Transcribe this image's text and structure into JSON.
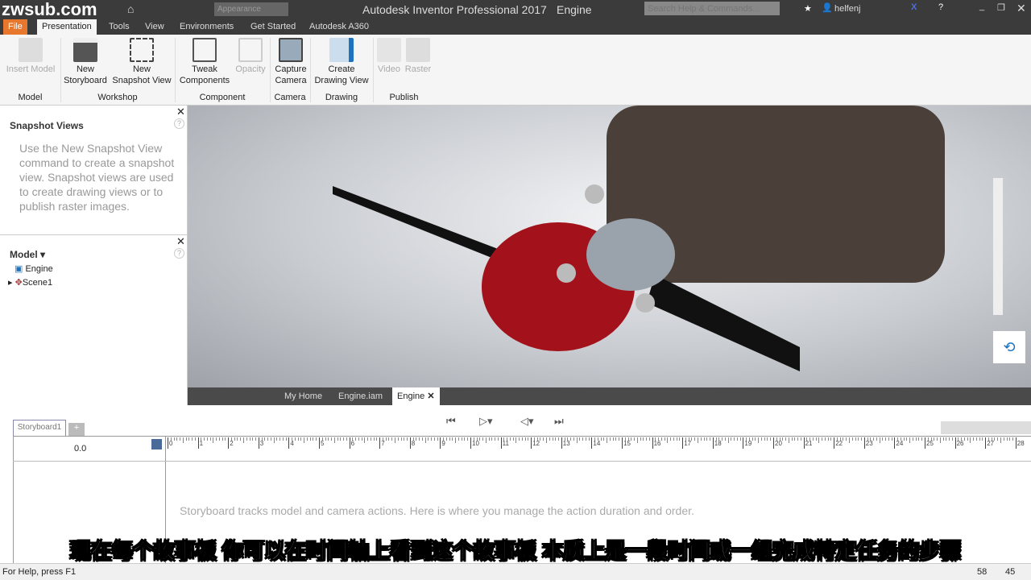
{
  "watermark": "zwsub.com",
  "title": {
    "app": "Autodesk Inventor Professional 2017",
    "doc": "Engine",
    "appearance": "Appearance",
    "search_placeholder": "Search Help & Commands...",
    "user": "helfenj"
  },
  "ribbon_tabs": [
    "File",
    "Presentation",
    "Tools",
    "View",
    "Environments",
    "Get Started",
    "Autodesk A360"
  ],
  "ribbon": {
    "buttons": [
      {
        "l1": "Insert Model",
        "l2": "",
        "disabled": true
      },
      {
        "l1": "New",
        "l2": "Storyboard",
        "disabled": false
      },
      {
        "l1": "New",
        "l2": "Snapshot View",
        "disabled": false
      },
      {
        "l1": "Tweak",
        "l2": "Components",
        "disabled": false
      },
      {
        "l1": "Opacity",
        "l2": "",
        "disabled": true
      },
      {
        "l1": "Capture",
        "l2": "Camera",
        "disabled": false
      },
      {
        "l1": "Create",
        "l2": "Drawing View",
        "disabled": false
      },
      {
        "l1": "Video",
        "l2": "",
        "disabled": true
      },
      {
        "l1": "Raster",
        "l2": "",
        "disabled": true
      }
    ],
    "groups": [
      "Model",
      "Workshop",
      "Component",
      "Camera",
      "Drawing",
      "Publish"
    ]
  },
  "snapshot_panel": {
    "title": "Snapshot Views",
    "help": "Use the New Snapshot View command to create a snapshot view. Snapshot views are used to create drawing views or to publish raster images."
  },
  "model_panel": {
    "title": "Model",
    "items": [
      "Engine",
      "Scene1"
    ]
  },
  "doc_tabs": [
    "My Home",
    "Engine.iam",
    "Engine"
  ],
  "storyboard": {
    "tab": "Storyboard1",
    "time": "0.0",
    "ticks": [
      "0",
      "1",
      "2",
      "3",
      "4",
      "5",
      "6",
      "7",
      "8",
      "9",
      "10",
      "11",
      "12",
      "13",
      "14",
      "15",
      "16",
      "17",
      "18",
      "19",
      "20",
      "21",
      "22",
      "23",
      "24",
      "25",
      "26",
      "27",
      "28"
    ],
    "hint": "Storyboard tracks model and camera actions. Here is where you manage the action duration and order."
  },
  "subtitle": "现在每个故事板  你可以在时间轴上看到这个故事板  本质上是一段时间或一组完成特定任务的步骤",
  "status": {
    "help": "For Help, press F1",
    "n1": "58",
    "n2": "45"
  },
  "colors": {
    "file_tab": "#e8772e",
    "model_red": "#a3121b",
    "accent": "#1e73be"
  }
}
